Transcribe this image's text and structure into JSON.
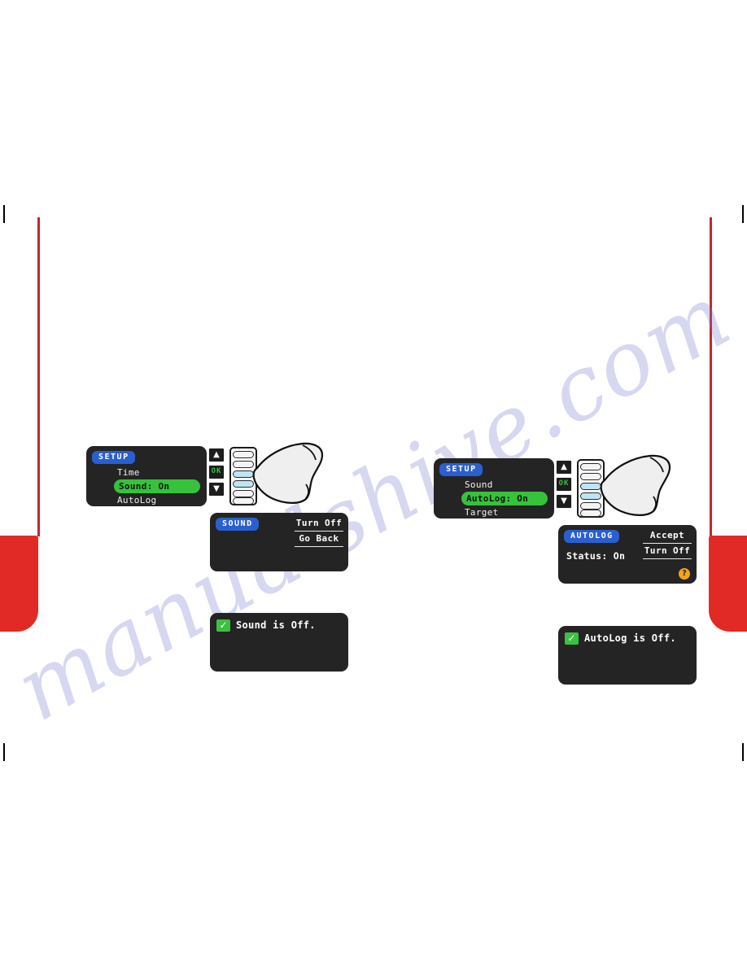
{
  "page": {
    "watermark": "manualshive.com",
    "accent_red": "#e12a26",
    "rule_red": "#c1272d",
    "lcd_bg": "#242424",
    "badge_blue": "#2a5fd0",
    "highlight_green": "#36c23b",
    "help_orange": "#f4a41c"
  },
  "left_flow": {
    "setup_screen": {
      "badge": "SETUP",
      "items": [
        {
          "label": "Time",
          "selected": false
        },
        {
          "label": "Sound: On",
          "selected": true
        },
        {
          "label": "AutoLog",
          "selected": false
        }
      ],
      "keys": {
        "up": "▲",
        "ok": "OK",
        "down": "▼"
      }
    },
    "sound_screen": {
      "badge": "SOUND",
      "softkeys": [
        "Turn Off",
        "Go Back"
      ]
    },
    "confirm_screen": {
      "check": "✓",
      "message": "Sound is Off."
    }
  },
  "right_flow": {
    "setup_screen": {
      "badge": "SETUP",
      "items": [
        {
          "label": "Sound",
          "selected": false
        },
        {
          "label": "AutoLog: On",
          "selected": true
        },
        {
          "label": "Target",
          "selected": false
        }
      ],
      "keys": {
        "up": "▲",
        "ok": "OK",
        "down": "▼"
      }
    },
    "autolog_screen": {
      "badge": "AUTOLOG",
      "status": "Status: On",
      "softkeys": [
        "Accept",
        "Turn Off"
      ],
      "help": "?"
    },
    "confirm_screen": {
      "check": "✓",
      "message": "AutoLog is Off."
    }
  }
}
